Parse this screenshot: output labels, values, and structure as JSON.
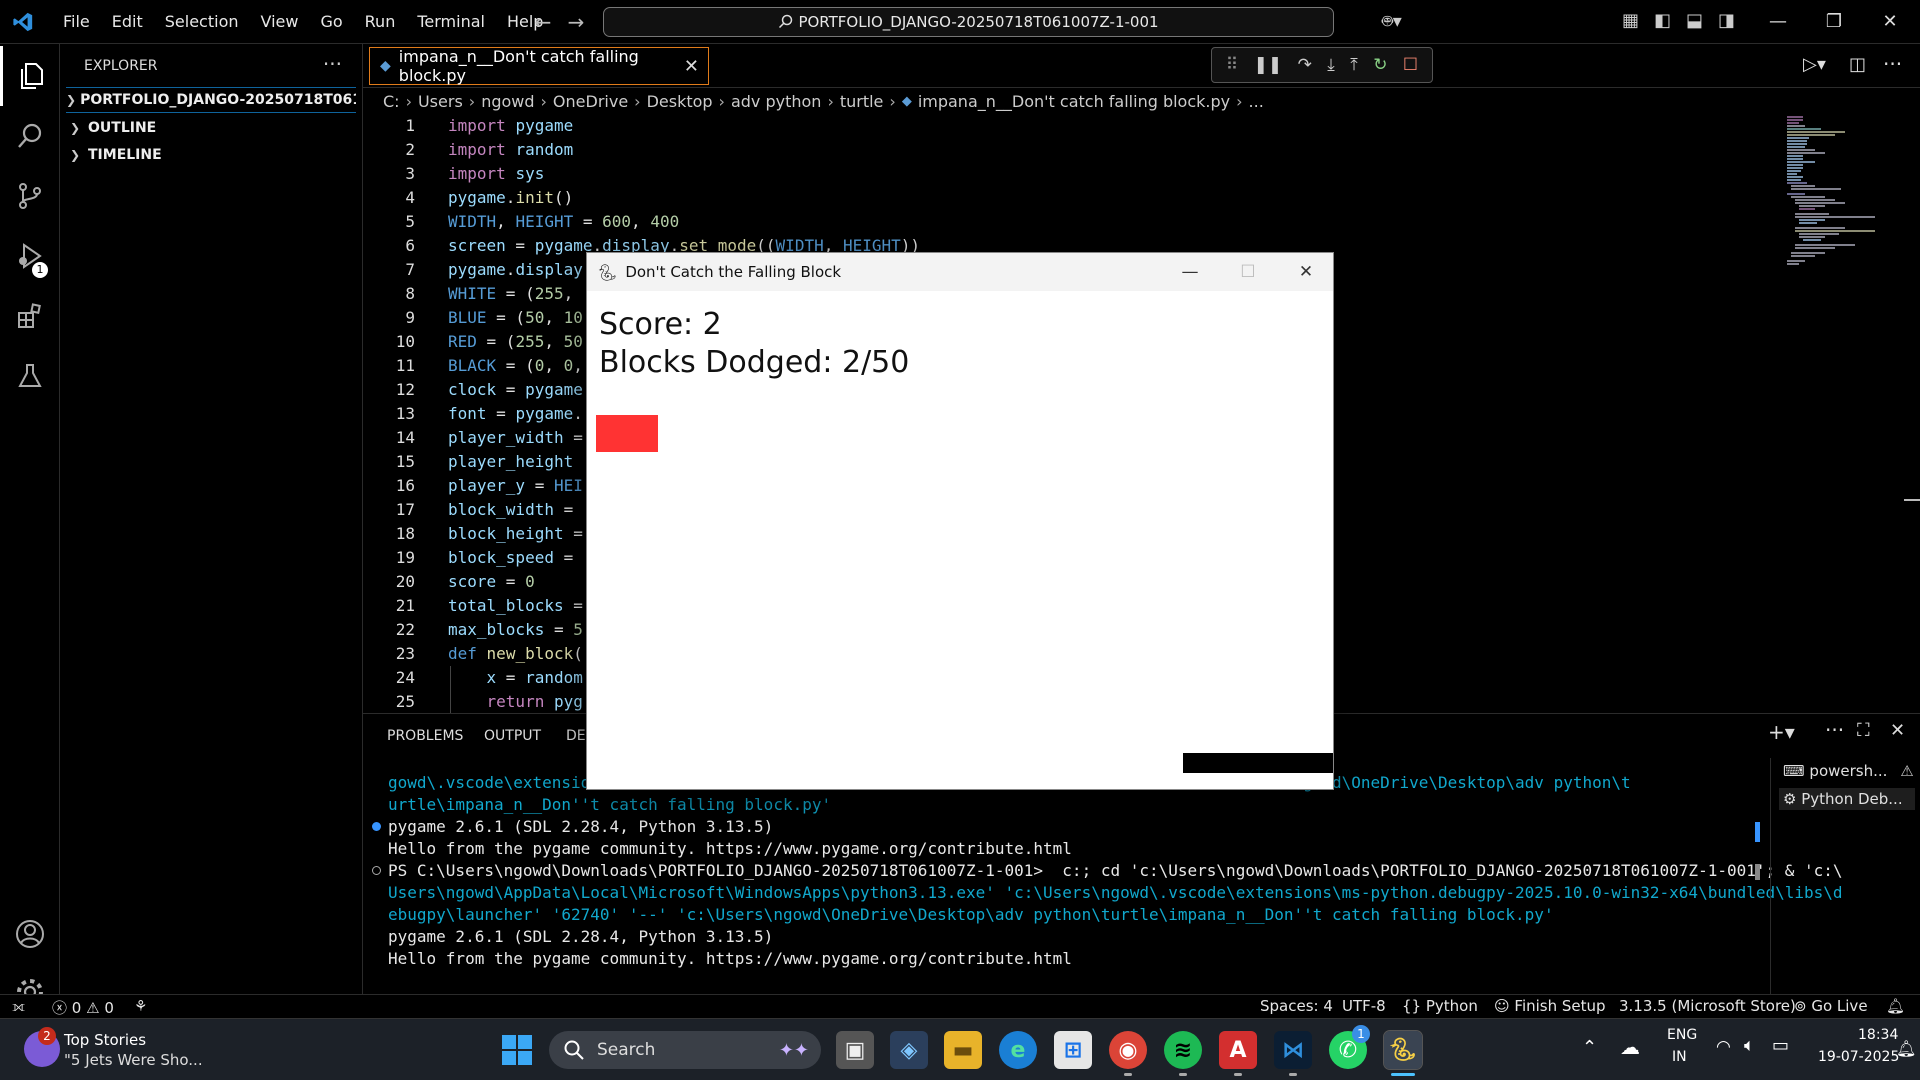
{
  "menu": [
    "File",
    "Edit",
    "Selection",
    "View",
    "Go",
    "Run",
    "Terminal",
    "Help"
  ],
  "command_center": "PORTFOLIO_DJANGO-20250718T061007Z-1-001",
  "sidebar": {
    "title": "EXPLORER",
    "more": "···",
    "sections": [
      "PORTFOLIO_DJANGO-20250718T061007...",
      "OUTLINE",
      "TIMELINE"
    ]
  },
  "activity": {
    "debug_badge": "1"
  },
  "tab": {
    "label": "impana_n__Don't catch falling block.py"
  },
  "breadcrumb": [
    "C:",
    "Users",
    "ngowd",
    "OneDrive",
    "Desktop",
    "adv python",
    "turtle",
    "impana_n__Don't catch falling block.py",
    "..."
  ],
  "code": [
    {
      "n": "1",
      "t": "import pygame"
    },
    {
      "n": "2",
      "t": "import random"
    },
    {
      "n": "3",
      "t": "import sys"
    },
    {
      "n": "4",
      "t": "pygame.init()"
    },
    {
      "n": "5",
      "t": "WIDTH, HEIGHT = 600, 400"
    },
    {
      "n": "6",
      "t": "screen = pygame.display.set_mode((WIDTH, HEIGHT))"
    },
    {
      "n": "7",
      "t": "pygame.display"
    },
    {
      "n": "8",
      "t": "WHITE = (255,"
    },
    {
      "n": "9",
      "t": "BLUE = (50, 10"
    },
    {
      "n": "10",
      "t": "RED = (255, 50"
    },
    {
      "n": "11",
      "t": "BLACK = (0, 0,"
    },
    {
      "n": "12",
      "t": "clock = pygame"
    },
    {
      "n": "13",
      "t": "font = pygame."
    },
    {
      "n": "14",
      "t": "player_width ="
    },
    {
      "n": "15",
      "t": "player_height"
    },
    {
      "n": "16",
      "t": "player_y = HEI"
    },
    {
      "n": "17",
      "t": "block_width ="
    },
    {
      "n": "18",
      "t": "block_height ="
    },
    {
      "n": "19",
      "t": "block_speed ="
    },
    {
      "n": "20",
      "t": "score = 0"
    },
    {
      "n": "21",
      "t": "total_blocks ="
    },
    {
      "n": "22",
      "t": "max_blocks = 5"
    },
    {
      "n": "23",
      "t": "def new_block("
    },
    {
      "n": "24",
      "t": "    x = random"
    },
    {
      "n": "25",
      "t": "    return pyg"
    }
  ],
  "panel": {
    "tabs": [
      "PROBLEMS",
      "OUTPUT",
      "DE"
    ]
  },
  "terminal": [
    "gowd\\.vscode\\extensio                                                               'c:\\Users\\ngowd\\OneDrive\\Desktop\\adv python\\t",
    "urtle\\impana_n__Don''t catch falling block.py'",
    "pygame 2.6.1 (SDL 2.28.4, Python 3.13.5)",
    "Hello from the pygame community. https://www.pygame.org/contribute.html",
    "PS C:\\Users\\ngowd\\Downloads\\PORTFOLIO_DJANGO-20250718T061007Z-1-001>  c:; cd 'c:\\Users\\ngowd\\Downloads\\PORTFOLIO_DJANGO-20250718T061007Z-1-001'; & 'c:\\",
    "Users\\ngowd\\AppData\\Local\\Microsoft\\WindowsApps\\python3.13.exe' 'c:\\Users\\ngowd\\.vscode\\extensions\\ms-python.debugpy-2025.10.0-win32-x64\\bundled\\libs\\d",
    "ebugpy\\launcher' '62740' '--' 'c:\\Users\\ngowd\\OneDrive\\Desktop\\adv python\\turtle\\impana_n__Don''t catch falling block.py'",
    "pygame 2.6.1 (SDL 2.28.4, Python 3.13.5)",
    "Hello from the pygame community. https://www.pygame.org/contribute.html"
  ],
  "terminal_list": [
    "powersh...",
    "Python Deb..."
  ],
  "game": {
    "title": "Don't Catch the Falling Block",
    "score": "Score: 2",
    "dodged": "Blocks Dodged: 2/50",
    "block_color": "#ff3333",
    "player_color": "#000000"
  },
  "status": {
    "errors": "0",
    "warnings": "0",
    "spaces": "Spaces: 4",
    "encoding": "UTF-8",
    "language": "Python",
    "finish_setup": "Finish Setup",
    "interpreter": "3.13.5 (Microsoft Store)",
    "golive": "Go Live"
  },
  "taskbar": {
    "news_title": "Top Stories",
    "news_sub": "\"5 Jets Were Sho...",
    "news_badge": "2",
    "search": "Search",
    "lang1": "ENG",
    "lang2": "IN",
    "time": "18:34",
    "date": "19-07-2025",
    "whatsapp_badge": "1"
  },
  "colors": {
    "accent": "#0e639c",
    "tab_border": "#e07b1a",
    "terminal_cyan": "#11a8cd"
  }
}
